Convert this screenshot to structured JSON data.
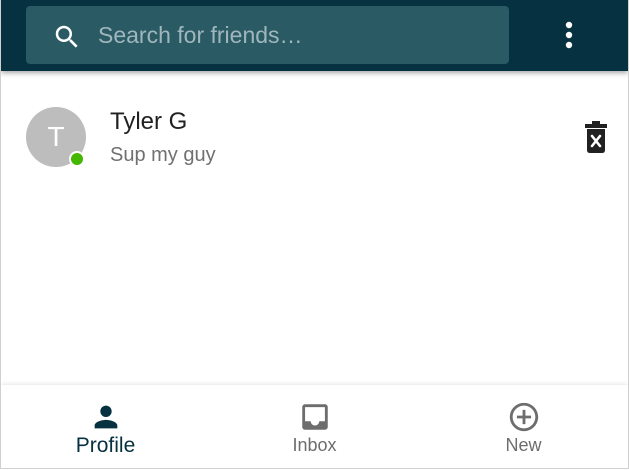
{
  "header": {
    "search": {
      "placeholder": "Search for friends…",
      "value": "",
      "icon": "search-icon"
    },
    "menu_icon": "more-vert-icon",
    "bar_color": "#053140",
    "search_box_color": "#2a5a64"
  },
  "conversations": [
    {
      "avatar_initial": "T",
      "name": "Tyler G",
      "preview": "Sup my guy",
      "online": true,
      "delete_icon": "trash-x-icon"
    }
  ],
  "bottom_nav": {
    "active": "Profile",
    "items": [
      {
        "label": "Profile",
        "icon": "person-icon"
      },
      {
        "label": "Inbox",
        "icon": "inbox-icon"
      },
      {
        "label": "New",
        "icon": "add-circle-icon"
      }
    ]
  },
  "colors": {
    "online": "#44b700",
    "avatar": "#bdbdbd",
    "active_nav": "#053140",
    "inactive_nav": "#6d6d6d"
  }
}
